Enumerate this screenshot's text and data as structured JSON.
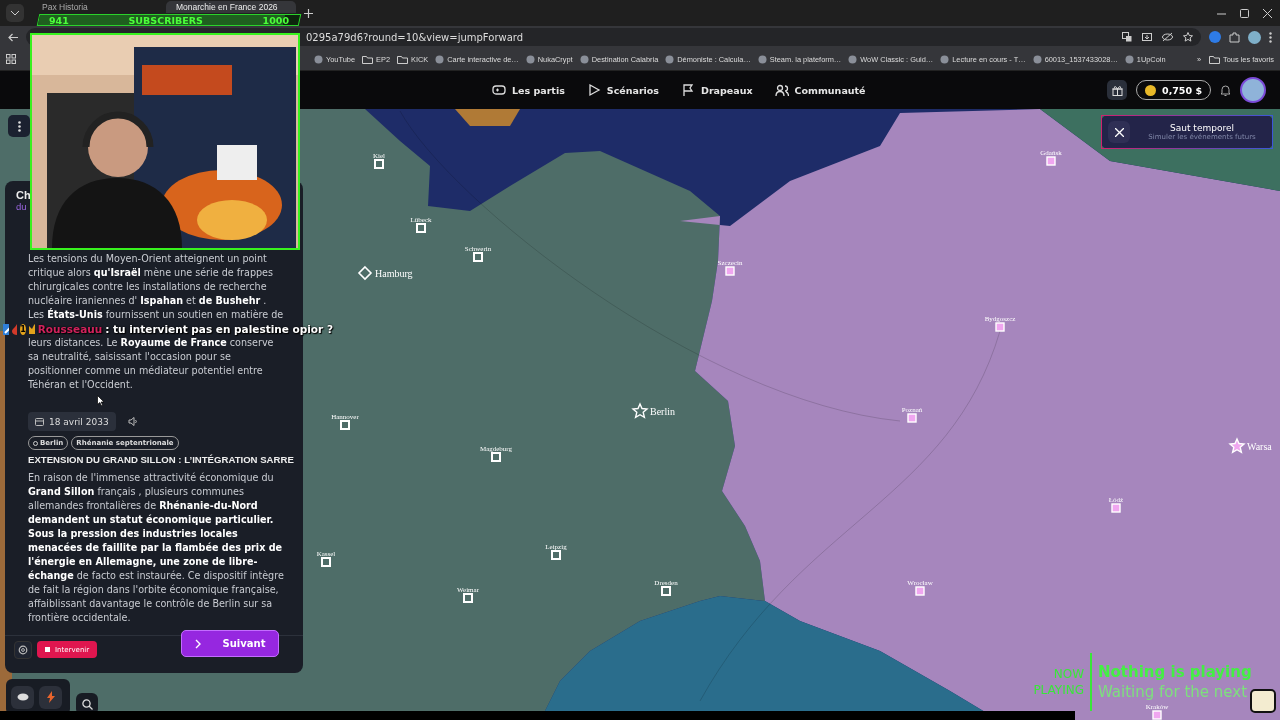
{
  "browser": {
    "tabs": [
      {
        "title": "Pax Historia",
        "selected": false
      },
      {
        "title": "Monarchie en France 2026",
        "selected": true
      }
    ],
    "url": "0295a79d6?round=10&view=jumpForward",
    "bookmarks": [
      {
        "label": "YouTube",
        "kind": "site"
      },
      {
        "label": "EP2",
        "kind": "folder"
      },
      {
        "label": "KICK",
        "kind": "folder"
      },
      {
        "label": "Carte interactive de…",
        "kind": "site"
      },
      {
        "label": "NukaCrypt",
        "kind": "site"
      },
      {
        "label": "Destination Calabria",
        "kind": "site"
      },
      {
        "label": "Démoniste : Calcula…",
        "kind": "site"
      },
      {
        "label": "Steam. la plateform…",
        "kind": "site"
      },
      {
        "label": "WoW Classic : Guid…",
        "kind": "site"
      },
      {
        "label": "Lecture en cours - T…",
        "kind": "site"
      },
      {
        "label": "60013_1537433028…",
        "kind": "site"
      },
      {
        "label": "1UpCoin",
        "kind": "site"
      }
    ],
    "more_bookmarks": "»",
    "all_bookmarks": "Tous les favoris"
  },
  "app": {
    "nav": [
      "Les partis",
      "Scénarios",
      "Drapeaux",
      "Communauté"
    ],
    "balance": "0,750 $"
  },
  "map": {
    "cities": [
      {
        "name": "Kiel",
        "kind": "city",
        "color": "#ffffff"
      },
      {
        "name": "Lübeck",
        "kind": "city",
        "color": "#ffffff"
      },
      {
        "name": "Schwerin",
        "kind": "city",
        "color": "#ffffff"
      },
      {
        "name": "Hamburg",
        "kind": "major",
        "color": "#ffffff"
      },
      {
        "name": "Szczecin",
        "kind": "city",
        "color": "#f0a6f0"
      },
      {
        "name": "Berlin",
        "kind": "capital",
        "color": "#ffffff"
      },
      {
        "name": "Hannover",
        "kind": "city",
        "color": "#ffffff"
      },
      {
        "name": "Magdeburg",
        "kind": "city",
        "color": "#ffffff"
      },
      {
        "name": "Leipzig",
        "kind": "city",
        "color": "#ffffff"
      },
      {
        "name": "Kassel",
        "kind": "city",
        "color": "#ffffff"
      },
      {
        "name": "Weimar",
        "kind": "city",
        "color": "#ffffff"
      },
      {
        "name": "Dresden",
        "kind": "city",
        "color": "#ffffff"
      },
      {
        "name": "Gdańsk",
        "kind": "city",
        "color": "#f0a6f0"
      },
      {
        "name": "Bydgoszcz",
        "kind": "city",
        "color": "#f0a6f0"
      },
      {
        "name": "Poznań",
        "kind": "city",
        "color": "#f0a6f0"
      },
      {
        "name": "Warsa",
        "kind": "capital",
        "color": "#f0a6f0"
      },
      {
        "name": "Łódź",
        "kind": "city",
        "color": "#f0a6f0"
      },
      {
        "name": "Wrocław",
        "kind": "city",
        "color": "#f0a6f0"
      },
      {
        "name": "Kraków",
        "kind": "city",
        "color": "#f0a6f0"
      }
    ]
  },
  "toast": {
    "title": "Saut temporel",
    "subtitle": "Simuler les événements futurs"
  },
  "panel": {
    "title": "Ch",
    "subtitle": "du",
    "first_event": {
      "text_before": "Les tensions du Moyen-Orient atteignent un point critique alors **qu'Israël** mène une série de frappes chirurgicales contre les installations de recherche nucléaire iraniennes d' **Ispahan** et **de Bushehr** . Les **États-Unis** fournissent un soutien en matière de",
      "text_after": "leurs distances. Le **Royaume de France** conserve sa neutralité, saisissant l'occasion pour se positionner comme un médiateur potentiel entre Téhéran et l'Occident."
    },
    "second_event": {
      "date": "18 avril 2033",
      "tags": [
        "Berlin",
        "Rhénanie septentrionale"
      ],
      "title": "EXTENSION DU GRAND SILLON : L’INTÉGRATION SARRE",
      "text": "En raison de l'immense attractivité économique du **Grand Sillon** français , plusieurs communes allemandes frontalières de **Rhénanie-du-Nord demandent un statut économique particulier. Sous la pression des industries locales menacées de faillite par la flambée des prix de l'énergie en Allemagne, une zone de libre-échange** de facto est instaurée. Ce dispositif intègre de fait la région dans l'orbite économique française, affaiblissant davantage le contrôle de Berlin sur sa frontière occidentale."
    },
    "intervene_button": "Intervenir",
    "next_button": "Suivant"
  },
  "stream_overlay": {
    "subscriber_goal": {
      "count": "941",
      "label": "SUBSCRIBERS",
      "goal": "1000",
      "level": 0.941
    },
    "chat": {
      "badge": "1",
      "user": "Rousseauu",
      "color": "#d0225c",
      "message": ": tu intervient pas en palestine opior ?"
    },
    "now_playing": {
      "label": "NOW PLAYING",
      "title": "Nothing is playing",
      "subtitle": "Waiting for the next"
    }
  }
}
